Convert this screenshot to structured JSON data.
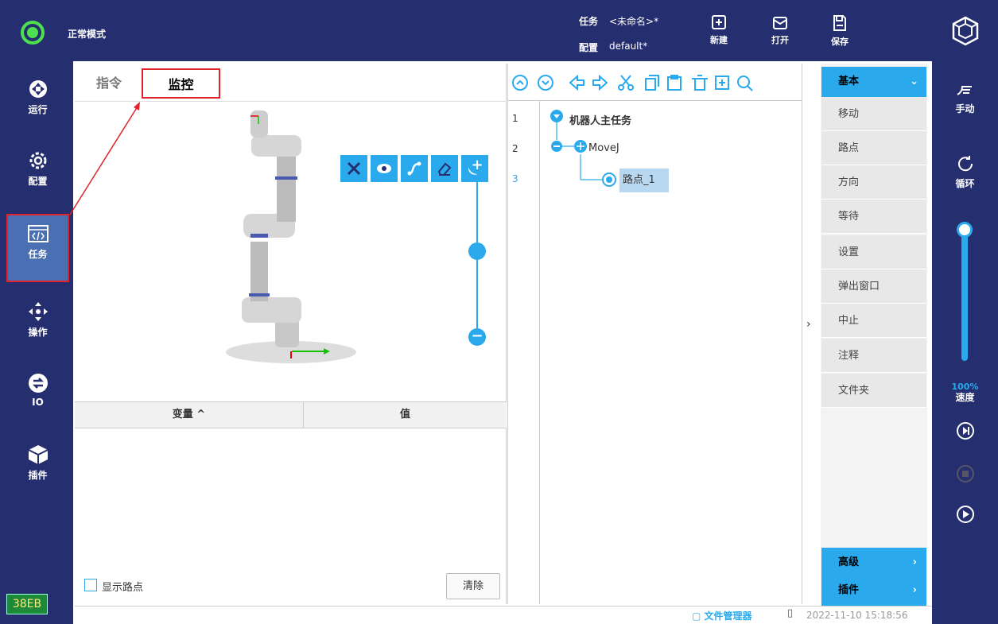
{
  "header": {
    "mode": "正常模式",
    "task_label": "任务",
    "task_value": "<未命名>*",
    "config_label": "配置",
    "config_value": "default*",
    "new_label": "新建",
    "open_label": "打开",
    "save_label": "保存"
  },
  "left_nav": [
    {
      "label": "运行"
    },
    {
      "label": "配置"
    },
    {
      "label": "任务"
    },
    {
      "label": "操作"
    },
    {
      "label": "IO"
    },
    {
      "label": "插件"
    }
  ],
  "left_nav_footer": "38EB",
  "panel": {
    "tabs": [
      "指令",
      "监控"
    ],
    "var_header": "变量 ^",
    "val_header": "值",
    "show_waypoints": "显示路点",
    "clear_button": "清除"
  },
  "tree": {
    "line_numbers": [
      "1",
      "2",
      "3"
    ],
    "nodes": [
      "机器人主任务",
      "MoveJ",
      "路点_1"
    ]
  },
  "commands": {
    "basic_header": "基本",
    "items": [
      "移动",
      "路点",
      "方向",
      "等待",
      "设置",
      "弹出窗口",
      "中止",
      "注释",
      "文件夹"
    ],
    "advanced": "高级",
    "plugins": "插件"
  },
  "right_nav": {
    "manual": "手动",
    "loop": "循环",
    "speed_value": "100%",
    "speed_label": "速度",
    "speed_fraction": 1.0
  },
  "status": {
    "file_manager": "文件管理器",
    "datetime": "2022-11-10 15:18:56"
  },
  "colors": {
    "nav_bg": "#252e6e",
    "accent": "#2aa9ec",
    "active_nav": "#4a6fb3",
    "highlight": "#e0232a",
    "selected_node": "#b8d8f2"
  }
}
